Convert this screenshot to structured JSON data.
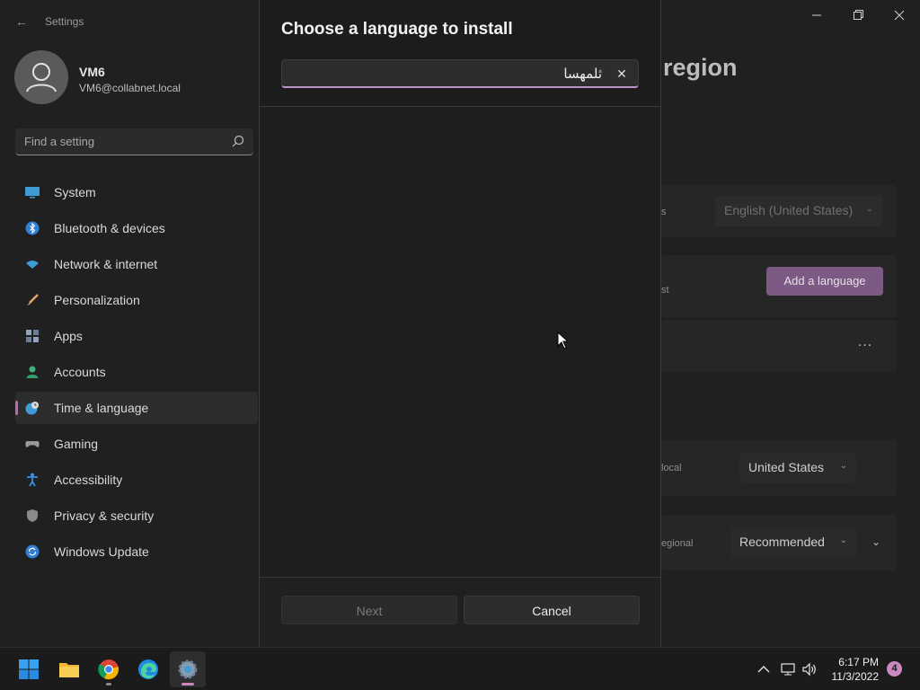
{
  "window": {
    "app_title": "Settings"
  },
  "user": {
    "name": "VM6",
    "email": "VM6@collabnet.local"
  },
  "search": {
    "placeholder": "Find a setting"
  },
  "sidebar": {
    "items": [
      {
        "label": "System",
        "icon": "monitor-icon",
        "color": "#4aa3df"
      },
      {
        "label": "Bluetooth & devices",
        "icon": "bluetooth-icon",
        "color": "#3a8ee6"
      },
      {
        "label": "Network & internet",
        "icon": "wifi-icon",
        "color": "#4aa3df"
      },
      {
        "label": "Personalization",
        "icon": "brush-icon",
        "color": "#e0a060"
      },
      {
        "label": "Apps",
        "icon": "apps-icon",
        "color": "#8a9bb0"
      },
      {
        "label": "Accounts",
        "icon": "person-icon",
        "color": "#3fb37f"
      },
      {
        "label": "Time & language",
        "icon": "globe-clock-icon",
        "color": "#4aa3df",
        "active": true
      },
      {
        "label": "Gaming",
        "icon": "gamepad-icon",
        "color": "#9a9a9a"
      },
      {
        "label": "Accessibility",
        "icon": "accessibility-icon",
        "color": "#3a8ee6"
      },
      {
        "label": "Privacy & security",
        "icon": "shield-icon",
        "color": "#8a8a8a"
      },
      {
        "label": "Windows Update",
        "icon": "update-icon",
        "color": "#3a8ee6"
      }
    ]
  },
  "page": {
    "heading_fragment": "region",
    "display_language_value": "English (United States)",
    "display_language_label_fragment": "s",
    "preferred_label_fragment": "st",
    "add_language_button": "Add a language",
    "more_options": "...",
    "country_label_fragment": "local",
    "country_value": "United States",
    "regional_label_fragment": "egional",
    "regional_value": "Recommended"
  },
  "dialog": {
    "title": "Choose a language to install",
    "search_value": "ثلمهسا",
    "clear_label": "✕",
    "next_button": "Next",
    "cancel_button": "Cancel"
  },
  "taskbar": {
    "apps": [
      "start-icon",
      "file-explorer-icon",
      "chrome-icon",
      "edge-icon",
      "settings-icon"
    ],
    "time": "6:17 PM",
    "date": "11/3/2022",
    "notification_count": "4"
  },
  "colors": {
    "accent": "#b896c6",
    "add_button": "#7c5a84",
    "badge": "#c988c0"
  }
}
